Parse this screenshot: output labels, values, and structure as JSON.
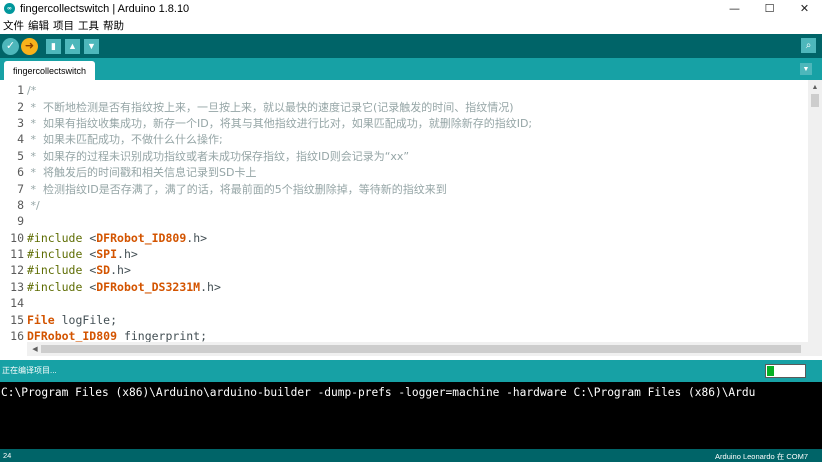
{
  "window": {
    "title": "fingercollectswitch | Arduino 1.8.10",
    "app_icon_glyph": "∞",
    "minimize_glyph": "—",
    "maximize_glyph": "☐",
    "close_glyph": "✕"
  },
  "menu": [
    "文件",
    "编辑",
    "项目",
    "工具",
    "帮助"
  ],
  "toolbar": {
    "verify_glyph": "✓",
    "upload_glyph": "➜",
    "new_glyph": "▮",
    "open_glyph": "▲",
    "save_glyph": "▼",
    "serial_monitor_glyph": "⌕"
  },
  "tabs": {
    "active": "fingercollectswitch",
    "menu_glyph": "▼"
  },
  "editor": {
    "lines": [
      {
        "n": "1",
        "segments": [
          {
            "t": "/*",
            "k": "comment"
          }
        ]
      },
      {
        "n": "2",
        "segments": [
          {
            "t": " *  不断地检测是否有指纹按上来，一旦按上来，就以最快的速度记录它(记录触发的时间、指纹情况)",
            "k": "comment"
          }
        ]
      },
      {
        "n": "3",
        "segments": [
          {
            "t": " *  如果有指纹收集成功，新存一个ID，将其与其他指纹进行比对，如果匹配成功，就删除新存的指纹ID;",
            "k": "comment"
          }
        ]
      },
      {
        "n": "4",
        "segments": [
          {
            "t": " *  如果未匹配成功，不做什么什么操作;",
            "k": "comment"
          }
        ]
      },
      {
        "n": "5",
        "segments": [
          {
            "t": " *  如果存的过程未识别成功指纹或者未成功保存指纹，指纹ID则会记录为“xx”",
            "k": "comment"
          }
        ]
      },
      {
        "n": "6",
        "segments": [
          {
            "t": " *  将触发后的时间戳和相关信息记录到SD卡上",
            "k": "comment"
          }
        ]
      },
      {
        "n": "7",
        "segments": [
          {
            "t": " *  检测指纹ID是否存满了，满了的话，将最前面的5个指纹删除掉，等待新的指纹来到",
            "k": "comment"
          }
        ]
      },
      {
        "n": "8",
        "segments": [
          {
            "t": " */",
            "k": "comment"
          }
        ]
      },
      {
        "n": "9",
        "segments": []
      },
      {
        "n": "10",
        "segments": [
          {
            "t": "#include",
            "k": "pre"
          },
          {
            "t": " <",
            "k": "plain"
          },
          {
            "t": "DFRobot_ID809",
            "k": "lib"
          },
          {
            "t": ".h>",
            "k": "plain"
          }
        ]
      },
      {
        "n": "11",
        "segments": [
          {
            "t": "#include",
            "k": "pre"
          },
          {
            "t": " <",
            "k": "plain"
          },
          {
            "t": "SPI",
            "k": "lib"
          },
          {
            "t": ".h>",
            "k": "plain"
          }
        ]
      },
      {
        "n": "12",
        "segments": [
          {
            "t": "#include",
            "k": "pre"
          },
          {
            "t": " <",
            "k": "plain"
          },
          {
            "t": "SD",
            "k": "lib"
          },
          {
            "t": ".h>",
            "k": "plain"
          }
        ]
      },
      {
        "n": "13",
        "segments": [
          {
            "t": "#include",
            "k": "pre"
          },
          {
            "t": " <",
            "k": "plain"
          },
          {
            "t": "DFRobot_DS3231M",
            "k": "lib"
          },
          {
            "t": ".h>",
            "k": "plain"
          }
        ]
      },
      {
        "n": "14",
        "segments": []
      },
      {
        "n": "15",
        "segments": [
          {
            "t": "File",
            "k": "lib"
          },
          {
            "t": " logFile;",
            "k": "plain"
          }
        ]
      },
      {
        "n": "16",
        "segments": [
          {
            "t": "DFRobot_ID809",
            "k": "lib"
          },
          {
            "t": " fingerprint;",
            "k": "plain"
          }
        ]
      }
    ],
    "scroll_up_glyph": "▲",
    "scroll_left_glyph": "◀"
  },
  "status": {
    "message": "正在编译项目...",
    "progress_fraction": 0.2,
    "progress_color": "#06b025"
  },
  "console": {
    "line": "C:\\Program Files (x86)\\Arduino\\arduino-builder -dump-prefs -logger=machine -hardware C:\\Program Files (x86)\\Ardu"
  },
  "footer": {
    "line_number": "24",
    "board": "Arduino Leonardo 在 COM7"
  },
  "colors": {
    "toolbar": "#006468",
    "tabbar": "#17a1a5",
    "comment": "#95a5a6",
    "preprocessor": "#5e6d03",
    "library": "#d35400"
  }
}
